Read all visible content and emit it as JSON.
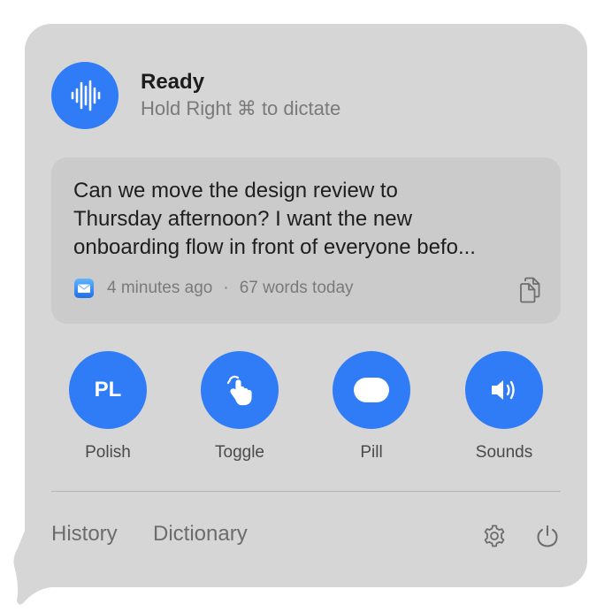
{
  "status": {
    "title": "Ready",
    "hint": "Hold Right ⌘ to dictate",
    "icon": "waveform-icon"
  },
  "transcript": {
    "text": "Can we move the design review to\nThursday afternoon? I want the new\nonboarding flow in front of everyone befo...",
    "app_icon": "mail-icon",
    "time_ago": "4 minutes ago",
    "separator": "·",
    "word_count": "67 words today",
    "copy_icon": "copy-icon"
  },
  "actions": [
    {
      "label": "Polish",
      "icon_text": "PL",
      "icon": "polish-icon"
    },
    {
      "label": "Toggle",
      "icon": "hand-pointer-icon"
    },
    {
      "label": "Pill",
      "icon": "pill-icon"
    },
    {
      "label": "Sounds",
      "icon": "speaker-icon"
    }
  ],
  "footer": {
    "history_label": "History",
    "dictionary_label": "Dictionary",
    "settings_icon": "gear-icon",
    "power_icon": "power-icon"
  },
  "colors": {
    "accent": "#2f7cf6",
    "panel": "#d6d6d6",
    "card": "#cbcbcb"
  }
}
